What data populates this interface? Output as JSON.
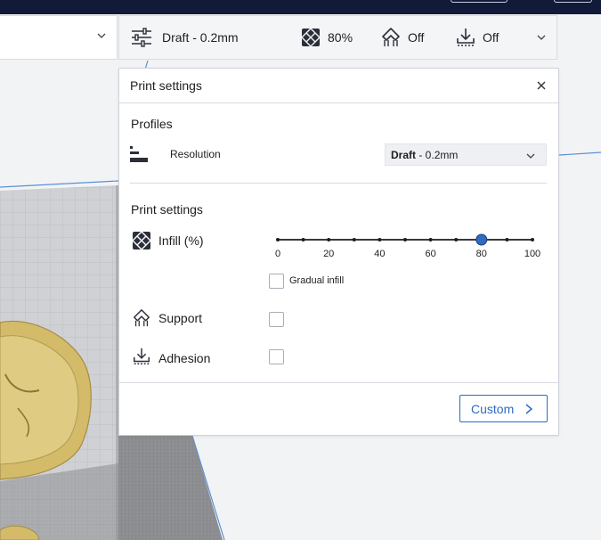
{
  "header_strip": {
    "profile_label": "Draft - 0.2mm",
    "infill_value": "80%",
    "support_value": "Off",
    "adhesion_value": "Off"
  },
  "panel": {
    "title": "Print settings",
    "profiles_section": "Profiles",
    "resolution_label": "Resolution",
    "resolution_value_bold": "Draft",
    "resolution_value_rest": " - 0.2mm",
    "print_settings_section": "Print settings",
    "infill_label": "Infill (%)",
    "infill_value": 80,
    "infill_ticks": [
      "0",
      "20",
      "40",
      "60",
      "80",
      "100"
    ],
    "gradual_infill_label": "Gradual infill",
    "gradual_infill_checked": false,
    "support_label": "Support",
    "support_checked": false,
    "adhesion_label": "Adhesion",
    "adhesion_checked": false,
    "custom_button": "Custom"
  },
  "colors": {
    "navy_bar": "#121a3a",
    "accent": "#2d6cc1",
    "build_plate": "#c9cacd",
    "model": "#d4bb6a"
  },
  "icons": {
    "profile": "sliders-icon",
    "infill": "infill-pattern-icon",
    "support": "support-icon",
    "adhesion": "adhesion-icon"
  }
}
